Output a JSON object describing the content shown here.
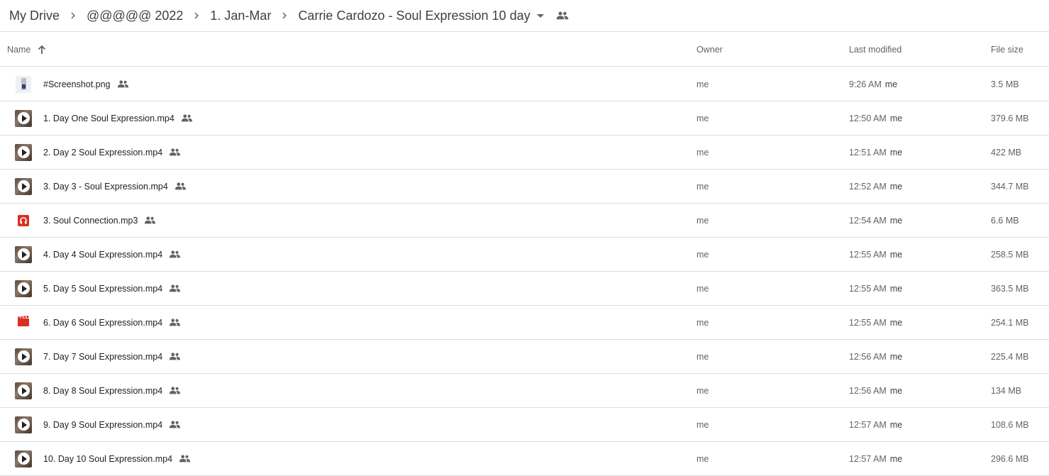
{
  "breadcrumb": {
    "items": [
      "My Drive",
      "@@@@@ 2022",
      "1. Jan-Mar",
      "Carrie Cardozo - Soul Expression 10 day"
    ]
  },
  "columns": {
    "name": "Name",
    "owner": "Owner",
    "last_modified": "Last modified",
    "file_size": "File size"
  },
  "colors": {
    "text": "#202124",
    "secondary": "#5f6368",
    "divider": "#dadce0",
    "red": "#d93025"
  },
  "files": [
    {
      "icon": "image-thumbnail-icon",
      "name": "#Screenshot.png",
      "owner": "me",
      "time": "9:26 AM",
      "by": "me",
      "size": "3.5 MB"
    },
    {
      "icon": "video-thumbnail-icon",
      "name": "1. Day One Soul Expression.mp4",
      "owner": "me",
      "time": "12:50 AM",
      "by": "me",
      "size": "379.6 MB"
    },
    {
      "icon": "video-thumbnail-icon",
      "name": "2. Day 2 Soul Expression.mp4",
      "owner": "me",
      "time": "12:51 AM",
      "by": "me",
      "size": "422 MB"
    },
    {
      "icon": "video-thumbnail-icon",
      "name": "3. Day 3 - Soul Expression.mp4",
      "owner": "me",
      "time": "12:52 AM",
      "by": "me",
      "size": "344.7 MB"
    },
    {
      "icon": "audio-file-icon",
      "name": "3. Soul Connection.mp3",
      "owner": "me",
      "time": "12:54 AM",
      "by": "me",
      "size": "6.6 MB"
    },
    {
      "icon": "video-thumbnail-icon",
      "name": "4. Day 4 Soul Expression.mp4",
      "owner": "me",
      "time": "12:55 AM",
      "by": "me",
      "size": "258.5 MB"
    },
    {
      "icon": "video-thumbnail-icon",
      "name": "5. Day 5 Soul Expression.mp4",
      "owner": "me",
      "time": "12:55 AM",
      "by": "me",
      "size": "363.5 MB"
    },
    {
      "icon": "video-file-icon",
      "name": "6. Day 6 Soul Expression.mp4",
      "owner": "me",
      "time": "12:55 AM",
      "by": "me",
      "size": "254.1 MB"
    },
    {
      "icon": "video-thumbnail-icon",
      "name": "7. Day 7 Soul Expression.mp4",
      "owner": "me",
      "time": "12:56 AM",
      "by": "me",
      "size": "225.4 MB"
    },
    {
      "icon": "video-thumbnail-icon",
      "name": "8. Day 8 Soul Expression.mp4",
      "owner": "me",
      "time": "12:56 AM",
      "by": "me",
      "size": "134 MB"
    },
    {
      "icon": "video-thumbnail-icon",
      "name": "9. Day 9 Soul Expression.mp4",
      "owner": "me",
      "time": "12:57 AM",
      "by": "me",
      "size": "108.6 MB"
    },
    {
      "icon": "video-thumbnail-icon",
      "name": "10. Day 10 Soul Expression.mp4",
      "owner": "me",
      "time": "12:57 AM",
      "by": "me",
      "size": "296.6 MB"
    }
  ]
}
